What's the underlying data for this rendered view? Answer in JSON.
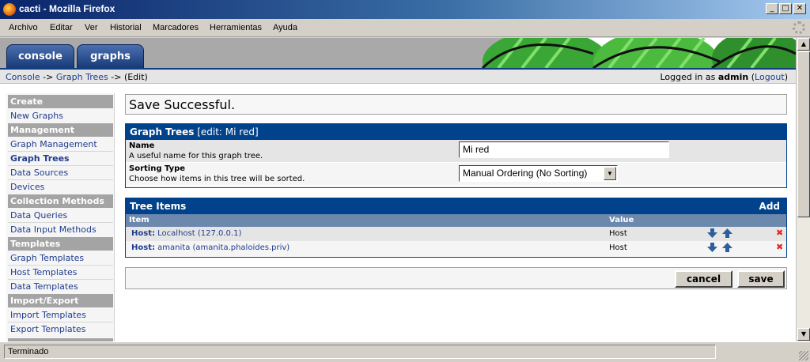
{
  "window": {
    "title": "cacti - Mozilla Firefox"
  },
  "menu": [
    "Archivo",
    "Editar",
    "Ver",
    "Historial",
    "Marcadores",
    "Herramientas",
    "Ayuda"
  ],
  "tabs": {
    "console": "console",
    "graphs": "graphs"
  },
  "breadcrumb": {
    "console": "Console",
    "sep1": " -> ",
    "trees": "Graph Trees",
    "sep2": " -> ",
    "current": "(Edit)"
  },
  "login": {
    "prefix": "Logged in as ",
    "user": "admin",
    "logout_open": " (",
    "logout": "Logout",
    "logout_close": ")"
  },
  "sidebar": [
    {
      "type": "header",
      "label": "Create"
    },
    {
      "type": "item",
      "label": "New Graphs"
    },
    {
      "type": "header",
      "label": "Management"
    },
    {
      "type": "item",
      "label": "Graph Management"
    },
    {
      "type": "item",
      "label": "Graph Trees",
      "active": true
    },
    {
      "type": "item",
      "label": "Data Sources"
    },
    {
      "type": "item",
      "label": "Devices"
    },
    {
      "type": "header",
      "label": "Collection Methods"
    },
    {
      "type": "item",
      "label": "Data Queries"
    },
    {
      "type": "item",
      "label": "Data Input Methods"
    },
    {
      "type": "header",
      "label": "Templates"
    },
    {
      "type": "item",
      "label": "Graph Templates"
    },
    {
      "type": "item",
      "label": "Host Templates"
    },
    {
      "type": "item",
      "label": "Data Templates"
    },
    {
      "type": "header",
      "label": "Import/Export"
    },
    {
      "type": "item",
      "label": "Import Templates"
    },
    {
      "type": "item",
      "label": "Export Templates"
    }
  ],
  "message": "Save Successful.",
  "graph_tree": {
    "title": "Graph Trees",
    "subtitle": " [edit: Mi red]",
    "name_label": "Name",
    "name_desc": "A useful name for this graph tree.",
    "name_value": "Mi red",
    "sort_label": "Sorting Type",
    "sort_desc": "Choose how items in this tree will be sorted.",
    "sort_value": "Manual Ordering (No Sorting)"
  },
  "tree_items": {
    "title": "Tree Items",
    "add": "Add",
    "col_item": "Item",
    "col_value": "Value",
    "rows": [
      {
        "prefix": "Host:",
        "name": " Localhost (127.0.0.1)",
        "value": "Host"
      },
      {
        "prefix": "Host:",
        "name": " amanita (amanita.phaloides.priv)",
        "value": "Host"
      }
    ]
  },
  "buttons": {
    "cancel": "cancel",
    "save": "save"
  },
  "status": "Terminado",
  "colors": {
    "panel_blue": "#00438c",
    "col_header": "#6d88ad",
    "link": "#1f3d8c",
    "delete_red": "#e0281e"
  }
}
